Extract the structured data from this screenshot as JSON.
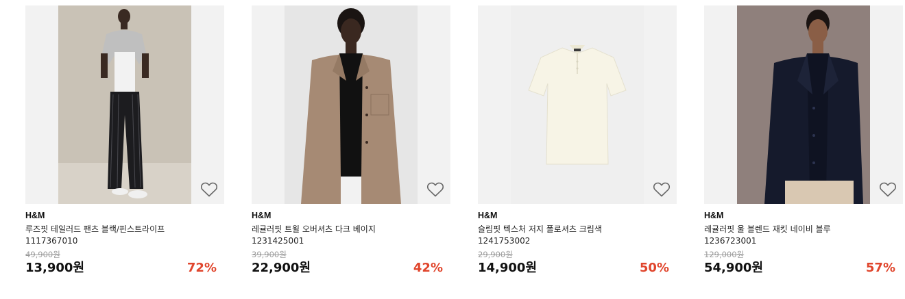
{
  "colors": {
    "discount": "#e0452c",
    "image_background": "#f2f2f2"
  },
  "products": [
    {
      "brand": "H&M",
      "name": "루즈핏 테일러드 팬츠 블랙/핀스트라이프",
      "code": "1117367010",
      "original_price": "49,900원",
      "price": "13,900원",
      "discount": "72%",
      "wishlist_icon": "heart-outline-icon"
    },
    {
      "brand": "H&M",
      "name": "레귤러핏 트윌 오버셔츠 다크 베이지",
      "code": "1231425001",
      "original_price": "39,900원",
      "price": "22,900원",
      "discount": "42%",
      "wishlist_icon": "heart-outline-icon"
    },
    {
      "brand": "H&M",
      "name": "슬림핏 텍스처 저지 폴로셔츠 크림색",
      "code": "1241753002",
      "original_price": "29,900원",
      "price": "14,900원",
      "discount": "50%",
      "wishlist_icon": "heart-outline-icon"
    },
    {
      "brand": "H&M",
      "name": "레귤러핏 울 블렌드 재킷 네이비 블루",
      "code": "1236723001",
      "original_price": "129,000원",
      "price": "54,900원",
      "discount": "57%",
      "wishlist_icon": "heart-outline-icon"
    }
  ]
}
